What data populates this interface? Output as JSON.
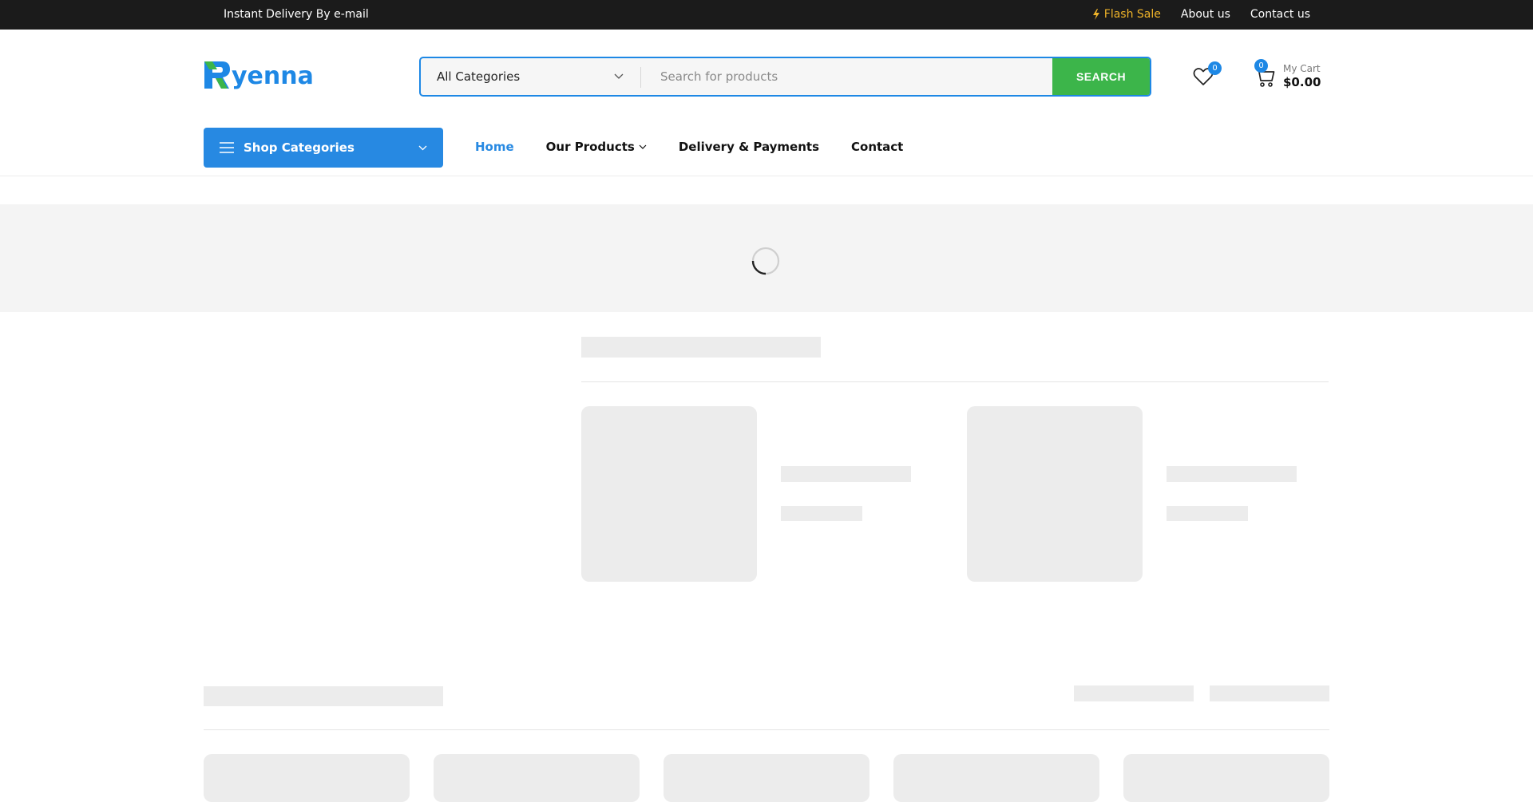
{
  "topbar": {
    "promo": "Instant Delivery By e-mail",
    "flash_sale": "Flash Sale",
    "about": "About us",
    "contact": "Contact us"
  },
  "brand": {
    "name": "Ryenna",
    "color": "#1e88e5",
    "accent": "#3cb54a"
  },
  "search": {
    "category": "All Categories",
    "placeholder": "Search for products",
    "button": "SEARCH"
  },
  "wishlist": {
    "count": "0"
  },
  "cart": {
    "count": "0",
    "label": "My Cart",
    "total": "$0.00"
  },
  "nav": {
    "shop_categories": "Shop Categories",
    "items": [
      "Home",
      "Our Products",
      "Delivery & Payments",
      "Contact"
    ]
  },
  "colors": {
    "nav_active": "#2789e2",
    "flash": "#f0b429",
    "skeleton": "#ececec"
  }
}
